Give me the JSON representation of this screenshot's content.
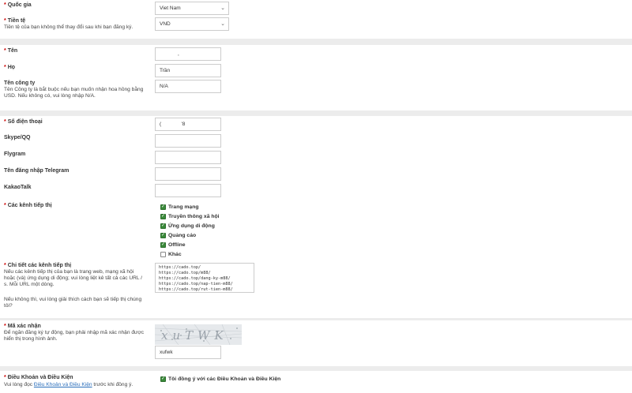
{
  "country": {
    "label": "Quốc gia",
    "value": "Viet Nam"
  },
  "currency": {
    "label": "Tiền tệ",
    "hint": "Tiền tệ của bạn không thể thay đổi sau khi bạn đăng ký.",
    "value": "VND"
  },
  "first_name": {
    "label": "Tên",
    "value": ","
  },
  "last_name": {
    "label": "Họ",
    "value": "Trần"
  },
  "company": {
    "label": "Tên công ty",
    "hint": "Tên Công ty là bắt buộc nếu bạn muốn nhận hoa hồng bằng USD. Nếu không có, vui lòng nhập N/A.",
    "value": "N/A"
  },
  "phone": {
    "label": "Số điện thoại",
    "value": "(              '8"
  },
  "skype": {
    "label": "Skype/QQ",
    "value": ""
  },
  "flygram": {
    "label": "Flygram",
    "value": ""
  },
  "telegram": {
    "label": "Tên đăng nhập Telegram",
    "value": ""
  },
  "kakao": {
    "label": "KakaoTalk",
    "value": ""
  },
  "channels": {
    "label": "Các kênh tiếp thị",
    "options": [
      {
        "label": "Trang mạng",
        "checked": true
      },
      {
        "label": "Truyền thông xã hội",
        "checked": true
      },
      {
        "label": "Ứng dụng di động",
        "checked": true
      },
      {
        "label": "Quảng cáo",
        "checked": true
      },
      {
        "label": "Offline",
        "checked": true
      },
      {
        "label": "Khác",
        "checked": false
      }
    ]
  },
  "channel_details": {
    "label": "Chi tiết các kênh tiếp thị",
    "hint1": "Nếu các kênh tiếp thị của bạn là trang web, mạng xã hội hoặc (và) ứng dụng di động; vui lòng liệt kê tất cả các URL / s. Mỗi URL một dòng.",
    "hint2": "Nếu không thì, vui lòng giải thích cách bạn sẽ tiếp thị chúng tôi?",
    "urls": [
      "https://cado.top/",
      "https://cado.top/m88/",
      "https://cado.top/dang-ky-m88/",
      "https://cado.top/nap-tien-m88/",
      "https://cado.top/rut-tien-m88/"
    ]
  },
  "captcha": {
    "label": "Mã xác nhận",
    "hint": "Để ngăn đăng ký tự động, bạn phải nhập mã xác nhận được hiển thị trong hình ảnh.",
    "image_text": "xuTWK",
    "value": "xufwk"
  },
  "terms": {
    "label": "Điều Khoản và Điều Kiện",
    "hint_before": "Vui lòng đọc ",
    "hint_link": "Điều Khoản và Điều Kiện",
    "hint_after": " trước khi đồng ý.",
    "checkbox_label": "Tôi đồng ý với các Điều Khoản và Điều Kiện",
    "checked": true
  },
  "colors": {
    "required": "#cc0000",
    "checkbox_on": "#3a8a3a",
    "link": "#2a6ebb"
  }
}
